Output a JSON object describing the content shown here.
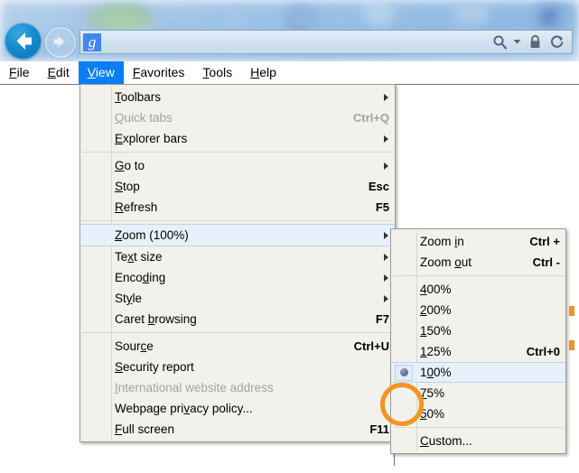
{
  "window": {
    "title": "Internet Explorer"
  },
  "toolbar": {
    "back_label": "Back",
    "forward_label": "Forward",
    "favicon_letter": "g",
    "address_value": "",
    "address_placeholder": "",
    "icons": [
      {
        "name": "search-icon",
        "label": "Search"
      },
      {
        "name": "chevron-down-icon",
        "label": "Search options"
      },
      {
        "name": "lock-icon",
        "label": "Secure"
      },
      {
        "name": "refresh-icon",
        "label": "Refresh"
      }
    ]
  },
  "menubar": {
    "items": [
      {
        "pre": "",
        "key": "F",
        "post": "ile",
        "active": false
      },
      {
        "pre": "",
        "key": "E",
        "post": "dit",
        "active": false
      },
      {
        "pre": "",
        "key": "V",
        "post": "iew",
        "active": true
      },
      {
        "pre": "",
        "key": "F",
        "post": "avorites",
        "active": false
      },
      {
        "pre": "",
        "key": "T",
        "post": "ools",
        "active": false
      },
      {
        "pre": "",
        "key": "H",
        "post": "elp",
        "active": false
      }
    ]
  },
  "view_menu": {
    "items": [
      {
        "type": "item",
        "pre": "",
        "key": "T",
        "post": "oolbars",
        "accel": "",
        "arrow": true,
        "disabled": false,
        "highlight": false
      },
      {
        "type": "item",
        "pre": "",
        "key": "Q",
        "post": "uick tabs",
        "accel": "Ctrl+Q",
        "arrow": false,
        "disabled": true,
        "highlight": false
      },
      {
        "type": "item",
        "pre": "",
        "key": "E",
        "post": "xplorer bars",
        "accel": "",
        "arrow": true,
        "disabled": false,
        "highlight": false
      },
      {
        "type": "separator"
      },
      {
        "type": "item",
        "pre": "",
        "key": "G",
        "post": "o to",
        "accel": "",
        "arrow": true,
        "disabled": false,
        "highlight": false
      },
      {
        "type": "item",
        "pre": "",
        "key": "S",
        "post": "top",
        "accel": "Esc",
        "arrow": false,
        "disabled": false,
        "highlight": false
      },
      {
        "type": "item",
        "pre": "",
        "key": "R",
        "post": "efresh",
        "accel": "F5",
        "arrow": false,
        "disabled": false,
        "highlight": false
      },
      {
        "type": "separator"
      },
      {
        "type": "item",
        "pre": "",
        "key": "Z",
        "post": "oom (100%)",
        "accel": "",
        "arrow": true,
        "disabled": false,
        "highlight": true
      },
      {
        "type": "item",
        "pre": "Te",
        "key": "x",
        "post": "t size",
        "accel": "",
        "arrow": true,
        "disabled": false,
        "highlight": false
      },
      {
        "type": "item",
        "pre": "Enco",
        "key": "d",
        "post": "ing",
        "accel": "",
        "arrow": true,
        "disabled": false,
        "highlight": false
      },
      {
        "type": "item",
        "pre": "St",
        "key": "y",
        "post": "le",
        "accel": "",
        "arrow": true,
        "disabled": false,
        "highlight": false
      },
      {
        "type": "item",
        "pre": "Caret ",
        "key": "b",
        "post": "rowsing",
        "accel": "F7",
        "arrow": false,
        "disabled": false,
        "highlight": false
      },
      {
        "type": "separator"
      },
      {
        "type": "item",
        "pre": "Sour",
        "key": "c",
        "post": "e",
        "accel": "Ctrl+U",
        "arrow": false,
        "disabled": false,
        "highlight": false
      },
      {
        "type": "item",
        "pre": "",
        "key": "S",
        "post": "ecurity report",
        "accel": "",
        "arrow": false,
        "disabled": false,
        "highlight": false
      },
      {
        "type": "item",
        "pre": "",
        "key": "I",
        "post": "nternational website address",
        "accel": "",
        "arrow": false,
        "disabled": true,
        "highlight": false
      },
      {
        "type": "item",
        "pre": "Webpage pri",
        "key": "v",
        "post": "acy policy...",
        "accel": "",
        "arrow": false,
        "disabled": false,
        "highlight": false
      },
      {
        "type": "item",
        "pre": "",
        "key": "F",
        "post": "ull screen",
        "accel": "F11",
        "arrow": false,
        "disabled": false,
        "highlight": false
      }
    ]
  },
  "zoom_menu": {
    "items": [
      {
        "type": "item",
        "pre": "Zoom ",
        "key": "i",
        "post": "n",
        "accel": "Ctrl +",
        "radio": false,
        "highlight": false
      },
      {
        "type": "item",
        "pre": "Zoom ",
        "key": "o",
        "post": "ut",
        "accel": "Ctrl -",
        "radio": false,
        "highlight": false
      },
      {
        "type": "separator"
      },
      {
        "type": "item",
        "pre": "",
        "key": "4",
        "post": "00%",
        "accel": "",
        "radio": false,
        "highlight": false
      },
      {
        "type": "item",
        "pre": "",
        "key": "2",
        "post": "00%",
        "accel": "",
        "radio": false,
        "highlight": false
      },
      {
        "type": "item",
        "pre": "",
        "key": "1",
        "post": "50%",
        "accel": "",
        "radio": false,
        "highlight": false
      },
      {
        "type": "item",
        "pre": "",
        "key": "1",
        "post": "25%",
        "accel": "Ctrl+0",
        "radio": false,
        "highlight": false
      },
      {
        "type": "item",
        "pre": "1",
        "key": "0",
        "post": "0%",
        "accel": "",
        "radio": true,
        "highlight": true
      },
      {
        "type": "item",
        "pre": "",
        "key": "7",
        "post": "5%",
        "accel": "",
        "radio": false,
        "highlight": false
      },
      {
        "type": "item",
        "pre": "",
        "key": "5",
        "post": "0%",
        "accel": "",
        "radio": false,
        "highlight": false
      },
      {
        "type": "separator"
      },
      {
        "type": "item",
        "pre": "",
        "key": "C",
        "post": "ustom...",
        "accel": "",
        "radio": false,
        "highlight": false
      }
    ]
  },
  "annotation": {
    "color": "#f59420",
    "target": "100%-radio-indicator"
  },
  "colors": {
    "menu_bg": "#f2f1ec",
    "menu_border": "#9a9a94",
    "highlight_bg": "#e8f1fb",
    "highlight_border": "#b9d4ef",
    "menubar_active_bg": "#0a7ff5",
    "disabled_text": "#a3a39d",
    "accent_orange": "#f59420",
    "favicon_blue": "#4285F4"
  }
}
